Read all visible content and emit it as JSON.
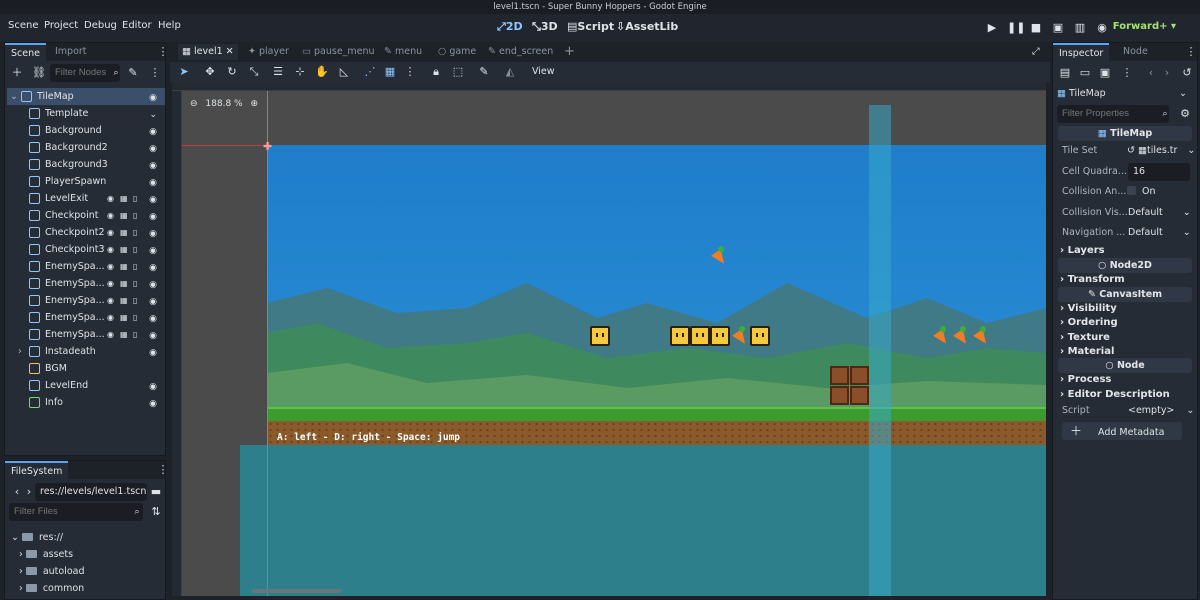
{
  "window": {
    "title": "level1.tscn - Super Bunny Hoppers - Godot Engine"
  },
  "menu": [
    "Scene",
    "Project",
    "Debug",
    "Editor",
    "Help"
  ],
  "workspaces": [
    {
      "label": "2D"
    },
    {
      "label": "3D"
    },
    {
      "label": "Script"
    },
    {
      "label": "AssetLib"
    }
  ],
  "renderer": "Forward+",
  "scene_dock": {
    "tabs": [
      "Scene",
      "Import"
    ],
    "filter_placeholder": "Filter Nodes",
    "nodes": [
      {
        "label": "TileMap",
        "icon_color": "#8ec7ff"
      },
      {
        "label": "Template",
        "icon_color": "#8ec7ff"
      },
      {
        "label": "Background",
        "icon_color": "#8ec7ff"
      },
      {
        "label": "Background2",
        "icon_color": "#8ec7ff"
      },
      {
        "label": "Background3",
        "icon_color": "#8ec7ff"
      },
      {
        "label": "PlayerSpawn",
        "icon_color": "#8ec7ff"
      },
      {
        "label": "LevelExit",
        "icon_color": "#8ec7ff"
      },
      {
        "label": "Checkpoint",
        "icon_color": "#8ec7ff"
      },
      {
        "label": "Checkpoint2",
        "icon_color": "#8ec7ff"
      },
      {
        "label": "Checkpoint3",
        "icon_color": "#8ec7ff"
      },
      {
        "label": "EnemySpa...",
        "icon_color": "#8ec7ff"
      },
      {
        "label": "EnemySpa...",
        "icon_color": "#8ec7ff"
      },
      {
        "label": "EnemySpa...",
        "icon_color": "#8ec7ff"
      },
      {
        "label": "EnemySpa...",
        "icon_color": "#8ec7ff"
      },
      {
        "label": "EnemySpa...",
        "icon_color": "#8ec7ff"
      },
      {
        "label": "Instadeath",
        "icon_color": "#8ec7ff"
      },
      {
        "label": "BGM",
        "icon_color": "#f0c060"
      },
      {
        "label": "LevelEnd",
        "icon_color": "#8ec7ff"
      },
      {
        "label": "Info",
        "icon_color": "#7ad86a"
      }
    ]
  },
  "filesystem": {
    "tab": "FileSystem",
    "path": "res://levels/level1.tscn",
    "filter_placeholder": "Filter Files",
    "items": [
      "res://",
      "assets",
      "autoload",
      "common"
    ]
  },
  "editor_tabs": [
    "level1",
    "player",
    "pause_menu",
    "menu",
    "game",
    "end_screen"
  ],
  "toolbar": {
    "view_label": "View"
  },
  "viewport": {
    "zoom": "188.8 %",
    "help_text": "A: left - D: right - Space: jump"
  },
  "inspector": {
    "tabs": [
      "Inspector",
      "Node"
    ],
    "object": "TileMap",
    "filter_placeholder": "Filter Properties",
    "class_header": "TileMap",
    "props": [
      {
        "name": "Tile Set",
        "value": "tiles.tr"
      },
      {
        "name": "Cell Quadra...",
        "value": "16"
      },
      {
        "name": "Collision An...",
        "value": "On"
      },
      {
        "name": "Collision Vis...",
        "value": "Default"
      },
      {
        "name": "Navigation ...",
        "value": "Default"
      }
    ],
    "groups_top": [
      "Layers"
    ],
    "node2d": "Node2D",
    "transform": "Transform",
    "canvasitem": "CanvasItem",
    "groups_mid": [
      "Visibility",
      "Ordering",
      "Texture",
      "Material"
    ],
    "node": "Node",
    "groups_bot": [
      "Process",
      "Editor Description"
    ],
    "script_label": "Script",
    "script_value": "<empty>",
    "add_metadata": "Add Metadata"
  }
}
